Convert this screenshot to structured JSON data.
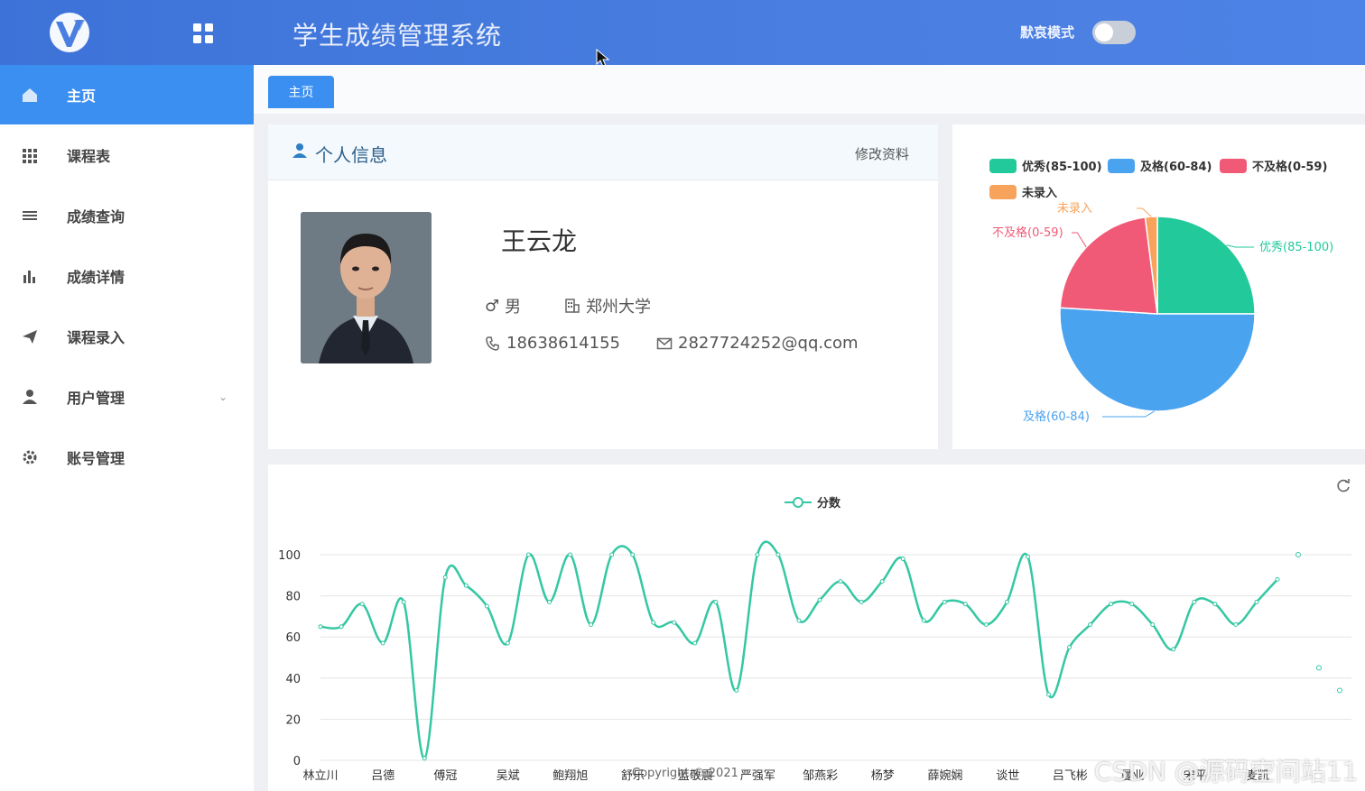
{
  "header": {
    "title": "学生成绩管理系统",
    "mourning_mode_label": "默哀模式",
    "mourning_mode_on": false,
    "accent_color": "#4a7ee0"
  },
  "sidebar": {
    "items": [
      {
        "label": "主页",
        "icon": "home-icon",
        "active": true
      },
      {
        "label": "课程表",
        "icon": "grid-icon",
        "active": false
      },
      {
        "label": "成绩查询",
        "icon": "list-icon",
        "active": false
      },
      {
        "label": "成绩详情",
        "icon": "bar-chart-icon",
        "active": false
      },
      {
        "label": "课程录入",
        "icon": "send-icon",
        "active": false
      },
      {
        "label": "用户管理",
        "icon": "user-icon",
        "active": false,
        "expandable": true
      },
      {
        "label": "账号管理",
        "icon": "gear-icon",
        "active": false
      }
    ],
    "active_color": "#3b8ff0"
  },
  "tabs": [
    {
      "label": "主页"
    }
  ],
  "profile": {
    "title": "个人信息",
    "edit_label": "修改资料",
    "name": "王云龙",
    "gender": "男",
    "school": "郑州大学",
    "phone": "18638614155",
    "email": "2827724252@qq.com"
  },
  "chart_data": [
    {
      "type": "pie",
      "legend": [
        "优秀(85-100)",
        "及格(60-84)",
        "不及格(0-59)",
        "未录入"
      ],
      "legend_placement": "top",
      "slices": [
        {
          "label": "优秀(85-100)",
          "value": 25,
          "color": "#22c99a"
        },
        {
          "label": "及格(60-84)",
          "value": 51,
          "color": "#4aa3ef"
        },
        {
          "label": "不及格(0-59)",
          "value": 22,
          "color": "#f05a77"
        },
        {
          "label": "未录入",
          "value": 2,
          "color": "#f7a35c"
        }
      ]
    },
    {
      "type": "line",
      "legend": [
        "分数"
      ],
      "legend_placement": "top",
      "series_color": "#35c7a3",
      "ylim": [
        0,
        100
      ],
      "yticks": [
        0,
        20,
        40,
        60,
        80,
        100
      ],
      "grid": true,
      "xtick_labels": [
        "林立川",
        "吕德",
        "傅冠",
        "吴斌",
        "鲍翔旭",
        "舒乐",
        "蓝敬震",
        "严强军",
        "邹燕彩",
        "杨梦",
        "薛婉娴",
        "谈世",
        "吕飞彬",
        "曼业",
        "宋平",
        "麦凯"
      ],
      "values": [
        65,
        65,
        76,
        57,
        77,
        1,
        89,
        85,
        75,
        57,
        100,
        77,
        100,
        66,
        100,
        100,
        67,
        67,
        57,
        77,
        34,
        100,
        100,
        68,
        78,
        87,
        77,
        87,
        98,
        68,
        77,
        76,
        66,
        77,
        99,
        32,
        55,
        66,
        76,
        76,
        66,
        54,
        77,
        76,
        66,
        77,
        88
      ],
      "extra_points": [
        100,
        45,
        34
      ]
    }
  ],
  "footer": {
    "copyright": "Copyright © 2021",
    "watermark": "CSDN @源码空间站11"
  }
}
